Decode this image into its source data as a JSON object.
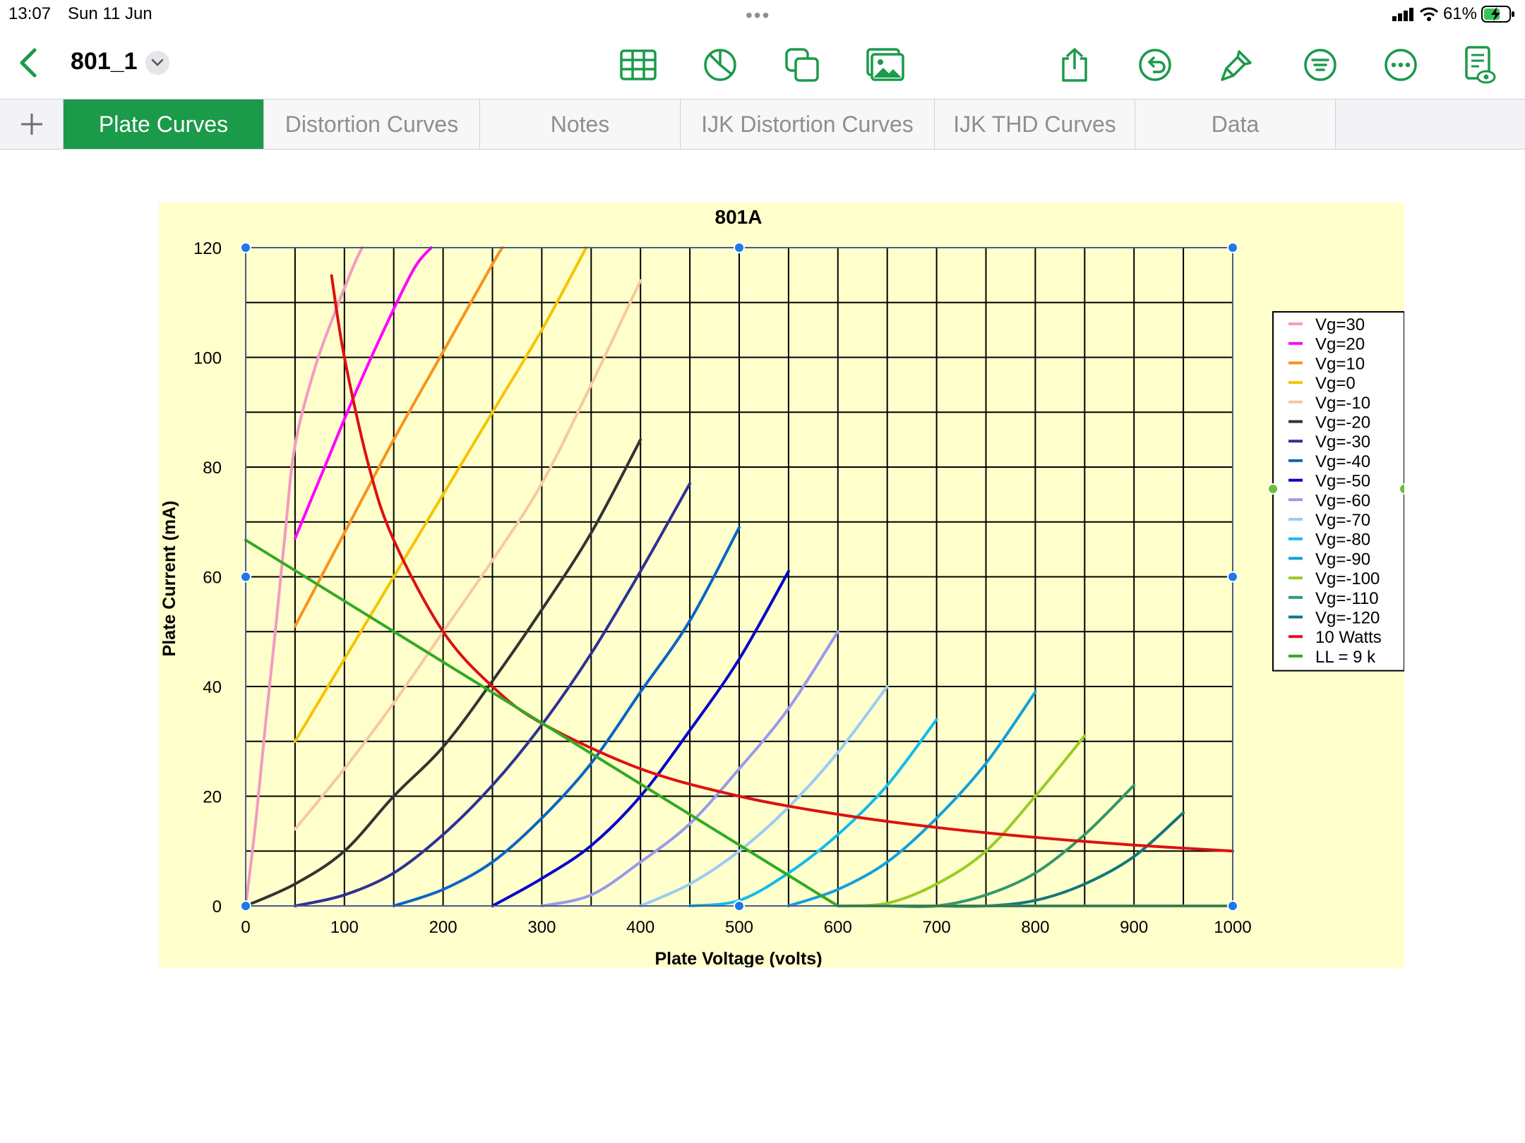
{
  "status": {
    "time": "13:07",
    "date": "Sun 11 Jun",
    "battery": "61%"
  },
  "document": {
    "title": "801_1"
  },
  "toolbar_icons": [
    "back-chevron-icon",
    "table-icon",
    "pie-chart-icon",
    "shapes-icon",
    "media-icon",
    "share-icon",
    "undo-icon",
    "format-brush-icon",
    "organize-icon",
    "more-icon",
    "document-view-icon"
  ],
  "tabs": [
    {
      "label": "Plate Curves",
      "active": true
    },
    {
      "label": "Distortion Curves",
      "active": false
    },
    {
      "label": "Notes",
      "active": false
    },
    {
      "label": "IJK Distortion Curves",
      "active": false
    },
    {
      "label": "IJK THD Curves",
      "active": false
    },
    {
      "label": "Data",
      "active": false
    }
  ],
  "colors": {
    "accent": "#1b9a4a",
    "chart_bg": "#ffffcc"
  },
  "chart_data": {
    "type": "line",
    "title": "801A",
    "xlabel": "Plate Voltage (volts)",
    "ylabel": "Plate Current (mA)",
    "xlim": [
      0,
      1000
    ],
    "ylim": [
      0,
      120
    ],
    "xticks": [
      0,
      100,
      200,
      300,
      400,
      500,
      600,
      700,
      800,
      900,
      1000
    ],
    "yticks": [
      0,
      20,
      40,
      60,
      80,
      100,
      120
    ],
    "grid": true,
    "legend_position": "right",
    "series": [
      {
        "name": "Vg=30",
        "color": "#f49ac1",
        "x": [
          0,
          10,
          20,
          30,
          40,
          50,
          70,
          90,
          110,
          118
        ],
        "y": [
          0,
          15,
          33,
          50,
          68,
          84,
          98,
          108,
          117,
          120
        ]
      },
      {
        "name": "Vg=20",
        "color": "#ff00ff",
        "x": [
          50,
          80,
          110,
          140,
          170,
          188
        ],
        "y": [
          67,
          80,
          93,
          105,
          116,
          120
        ]
      },
      {
        "name": "Vg=10",
        "color": "#f7931e",
        "x": [
          50,
          100,
          150,
          200,
          250,
          260
        ],
        "y": [
          51,
          68,
          85,
          101,
          117,
          120
        ]
      },
      {
        "name": "Vg=0",
        "color": "#f5c400",
        "x": [
          50,
          100,
          150,
          200,
          250,
          300,
          345
        ],
        "y": [
          30,
          45,
          60,
          75,
          90,
          105,
          120
        ]
      },
      {
        "name": "Vg=-10",
        "color": "#f8c8a0",
        "x": [
          50,
          100,
          150,
          200,
          250,
          300,
          350,
          400
        ],
        "y": [
          14,
          25,
          37,
          50,
          63,
          77,
          95,
          114
        ]
      },
      {
        "name": "Vg=-20",
        "color": "#333333",
        "x": [
          0,
          50,
          100,
          150,
          200,
          250,
          300,
          350,
          400
        ],
        "y": [
          0,
          4,
          10,
          20,
          29,
          41,
          54,
          68,
          85
        ]
      },
      {
        "name": "Vg=-30",
        "color": "#2e3192",
        "x": [
          50,
          100,
          150,
          200,
          250,
          300,
          350,
          400,
          450
        ],
        "y": [
          0,
          2,
          6,
          13,
          22,
          33,
          46,
          61,
          77
        ]
      },
      {
        "name": "Vg=-40",
        "color": "#0b63c5",
        "x": [
          150,
          200,
          250,
          300,
          350,
          400,
          450,
          500
        ],
        "y": [
          0,
          3,
          8,
          16,
          26,
          39,
          52,
          69
        ]
      },
      {
        "name": "Vg=-50",
        "color": "#0000cc",
        "x": [
          250,
          300,
          350,
          400,
          450,
          500,
          550
        ],
        "y": [
          0,
          5,
          11,
          20,
          32,
          45,
          61
        ]
      },
      {
        "name": "Vg=-60",
        "color": "#9999ee",
        "x": [
          300,
          350,
          400,
          450,
          500,
          550,
          600
        ],
        "y": [
          0,
          2,
          8,
          15,
          25,
          36,
          50
        ]
      },
      {
        "name": "Vg=-70",
        "color": "#99ccf5",
        "x": [
          400,
          450,
          500,
          550,
          600,
          650
        ],
        "y": [
          0,
          4,
          10,
          18,
          28,
          40
        ]
      },
      {
        "name": "Vg=-80",
        "color": "#11bbee",
        "x": [
          450,
          500,
          550,
          600,
          650,
          700
        ],
        "y": [
          0,
          1,
          6,
          13,
          22,
          34
        ]
      },
      {
        "name": "Vg=-90",
        "color": "#11a0dd",
        "x": [
          550,
          600,
          650,
          700,
          750,
          800
        ],
        "y": [
          0,
          3,
          8,
          16,
          26,
          39
        ]
      },
      {
        "name": "Vg=-100",
        "color": "#99cc22",
        "x": [
          600,
          650,
          700,
          750,
          800,
          850
        ],
        "y": [
          0,
          0.5,
          4,
          10,
          20,
          31
        ]
      },
      {
        "name": "Vg=-110",
        "color": "#339966",
        "x": [
          650,
          700,
          750,
          800,
          850,
          900
        ],
        "y": [
          0,
          0,
          2,
          6,
          13,
          22
        ]
      },
      {
        "name": "Vg=-120",
        "color": "#117777",
        "x": [
          700,
          750,
          800,
          850,
          900,
          950
        ],
        "y": [
          0,
          0,
          1,
          4,
          9,
          17
        ]
      },
      {
        "name": "10 Watts",
        "color": "#dd1111",
        "x": [
          87,
          100,
          125,
          150,
          200,
          250,
          300,
          400,
          500,
          600,
          700,
          800,
          900,
          1000
        ],
        "y": [
          114.9,
          100,
          80,
          66.7,
          50,
          40,
          33.3,
          25,
          20,
          16.7,
          14.3,
          12.5,
          11.1,
          10
        ]
      },
      {
        "name": "LL = 9 k",
        "color": "#33aa22",
        "x": [
          0,
          600,
          1000
        ],
        "y": [
          66.7,
          0,
          0
        ]
      }
    ]
  }
}
